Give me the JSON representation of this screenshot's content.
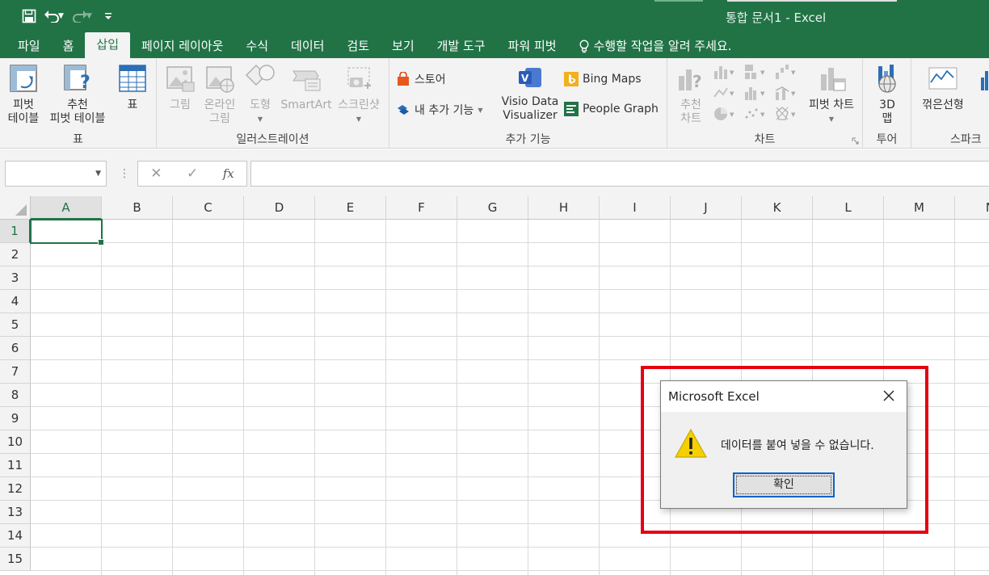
{
  "window": {
    "title": "통합 문서1 - Excel"
  },
  "qat": {
    "save_icon": "save-icon",
    "undo_icon": "undo-icon",
    "redo_icon": "redo-icon",
    "customize_icon": "customize-qat-icon"
  },
  "tabs": [
    {
      "label": "파일"
    },
    {
      "label": "홈"
    },
    {
      "label": "삽입"
    },
    {
      "label": "페이지 레이아웃"
    },
    {
      "label": "수식"
    },
    {
      "label": "데이터"
    },
    {
      "label": "검토"
    },
    {
      "label": "보기"
    },
    {
      "label": "개발 도구"
    },
    {
      "label": "파워 피벗"
    }
  ],
  "tell_me": {
    "label": "수행할 작업을 알려 주세요."
  },
  "ribbon": {
    "tables": {
      "label": "표",
      "pivot_table": {
        "line1": "피벗",
        "line2": "테이블"
      },
      "recommended_pivot": {
        "line1": "추천",
        "line2": "피벗 테이블"
      },
      "table": {
        "line1": "표"
      }
    },
    "illustrations": {
      "label": "일러스트레이션",
      "picture": {
        "line1": "그림"
      },
      "online_picture": {
        "line1": "온라인",
        "line2": "그림"
      },
      "shapes": {
        "line1": "도형"
      },
      "smartart": {
        "line1": "SmartArt"
      },
      "screenshot": {
        "line1": "스크린샷"
      }
    },
    "addins": {
      "label": "추가 기능",
      "store": "스토어",
      "my_addins": "내 추가 기능",
      "visio": {
        "line1": "Visio Data",
        "line2": "Visualizer"
      },
      "bing_maps": "Bing Maps",
      "people_graph": "People Graph"
    },
    "charts": {
      "label": "차트",
      "recommended": {
        "line1": "추천",
        "line2": "차트"
      },
      "pivot_chart": {
        "line1": "피벗 차트"
      }
    },
    "tours": {
      "label": "투어",
      "map3d": {
        "line1": "3D",
        "line2": "맵"
      }
    },
    "sparklines": {
      "label": "스파크",
      "line": {
        "line1": "꺾은선형"
      }
    }
  },
  "formula_bar": {
    "name_box": "",
    "formula": "",
    "fx": "fx"
  },
  "grid": {
    "columns": [
      "A",
      "B",
      "C",
      "D",
      "E",
      "F",
      "G",
      "H",
      "I",
      "J",
      "K",
      "L",
      "M",
      "N"
    ],
    "rows": [
      "1",
      "2",
      "3",
      "4",
      "5",
      "6",
      "7",
      "8",
      "9",
      "10",
      "11",
      "12",
      "13",
      "14",
      "15"
    ],
    "active_cell": "A1"
  },
  "dialog": {
    "title": "Microsoft Excel",
    "message": "데이터를 붙여 넣을 수 없습니다.",
    "ok_label": "확인",
    "icon": "warning-icon"
  },
  "colors": {
    "accent": "#217346",
    "highlight": "#e60012",
    "warning": "#f5d000"
  }
}
